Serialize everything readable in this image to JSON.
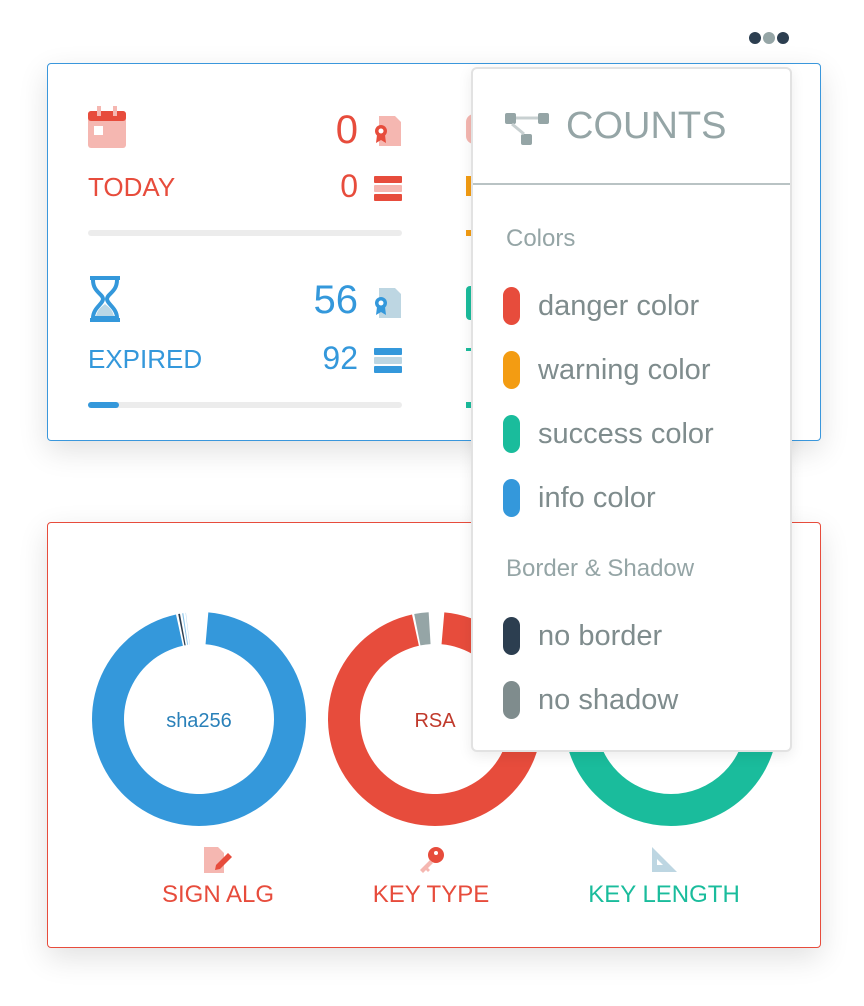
{
  "colors": {
    "danger": "#e74c3c",
    "warning": "#f39c12",
    "success": "#1abc9c",
    "info": "#3498db",
    "dark": "#2c3e50",
    "muted": "#95a5a6"
  },
  "stats": {
    "today": {
      "label": "TODAY",
      "certificates": "0",
      "servers": "0",
      "progress": 0
    },
    "expired": {
      "label": "EXPIRED",
      "certificates": "56",
      "servers": "92",
      "progress": 0.1
    }
  },
  "menu": {
    "title": "COUNTS",
    "sections": [
      {
        "title": "Colors",
        "items": [
          {
            "label": "danger color",
            "color": "#e74c3c"
          },
          {
            "label": "warning color",
            "color": "#f39c12"
          },
          {
            "label": "success color",
            "color": "#1abc9c"
          },
          {
            "label": "info color",
            "color": "#3498db"
          }
        ]
      },
      {
        "title": "Border & Shadow",
        "items": [
          {
            "label": "no border",
            "color": "#2c3e50"
          },
          {
            "label": "no shadow",
            "color": "#7f8c8d"
          }
        ]
      }
    ]
  },
  "charts": [
    {
      "label": "SIGN ALG",
      "center": "sha256",
      "label_color": "#e74c3c",
      "center_color": "#2980b9",
      "segments": [
        {
          "value": 95.5,
          "color": "#3498db"
        },
        {
          "value": 0.6,
          "color": "#2c3e50"
        },
        {
          "value": 0.5,
          "color": "#85c1e9"
        },
        {
          "value": 0.4,
          "color": "#aed6f1"
        }
      ]
    },
    {
      "label": "KEY TYPE",
      "center": "RSA",
      "label_color": "#e74c3c",
      "center_color": "#c0392b",
      "segments": [
        {
          "value": 95.5,
          "color": "#e74c3c"
        },
        {
          "value": 2.5,
          "color": "#95a5a6"
        }
      ]
    },
    {
      "label": "KEY LENGTH",
      "center": "",
      "label_color": "#1abc9c",
      "center_color": "#16a085",
      "segments": [
        {
          "value": 100,
          "color": "#1abc9c"
        }
      ]
    }
  ]
}
